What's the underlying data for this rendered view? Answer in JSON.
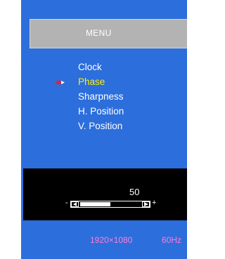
{
  "menu": {
    "title": "MENU",
    "items": [
      {
        "label": "Clock",
        "selected": false
      },
      {
        "label": "Phase",
        "selected": true
      },
      {
        "label": "Sharpness",
        "selected": false
      },
      {
        "label": "H. Position",
        "selected": false
      },
      {
        "label": "V. Position",
        "selected": false
      }
    ]
  },
  "slider": {
    "value": "50",
    "min_symbol": "-",
    "max_symbol": "+",
    "level_percent": 50
  },
  "status": {
    "resolution": "1920×1080",
    "refresh": "60Hz"
  },
  "colors": {
    "background": "#2c6edc",
    "selected_text": "#ffee00",
    "status_text": "#ff7fd6",
    "cursor": "#e0223b"
  },
  "icons": {
    "cursor": "pencil-cursor-icon",
    "left": "left-arrow-icon",
    "right": "right-arrow-icon"
  }
}
